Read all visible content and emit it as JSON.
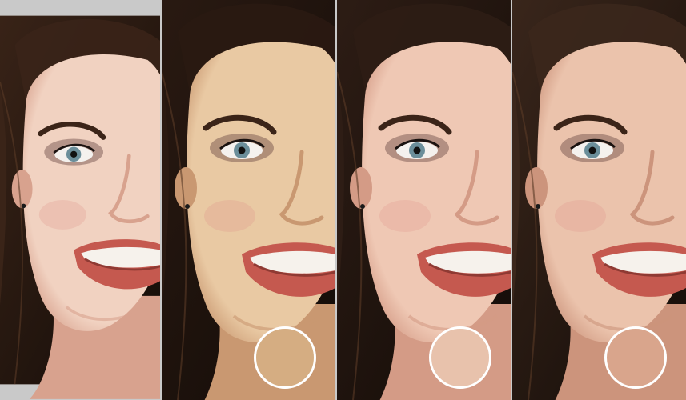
{
  "image": {
    "subject": "portrait",
    "panels": [
      {
        "variant": "original",
        "skin": "#f1d2c1",
        "shadow": "#d8a28e",
        "hair": "#3a2418",
        "background": "#eee6df",
        "swatch": null
      },
      {
        "variant": "tone-1",
        "skin": "#e9c9a3",
        "shadow": "#c99871",
        "hair": "#2a1a12",
        "background": "#2c2018",
        "swatch": "#d5ad82"
      },
      {
        "variant": "tone-2",
        "skin": "#efc8b4",
        "shadow": "#d49b86",
        "hair": "#2e1d15",
        "background": "#2b1e16",
        "swatch": "#e8c2ac"
      },
      {
        "variant": "tone-3",
        "skin": "#ebc3ac",
        "shadow": "#cc947c",
        "hair": "#3b271c",
        "background": "#4d3527",
        "swatch": "#d9a58c"
      }
    ]
  }
}
